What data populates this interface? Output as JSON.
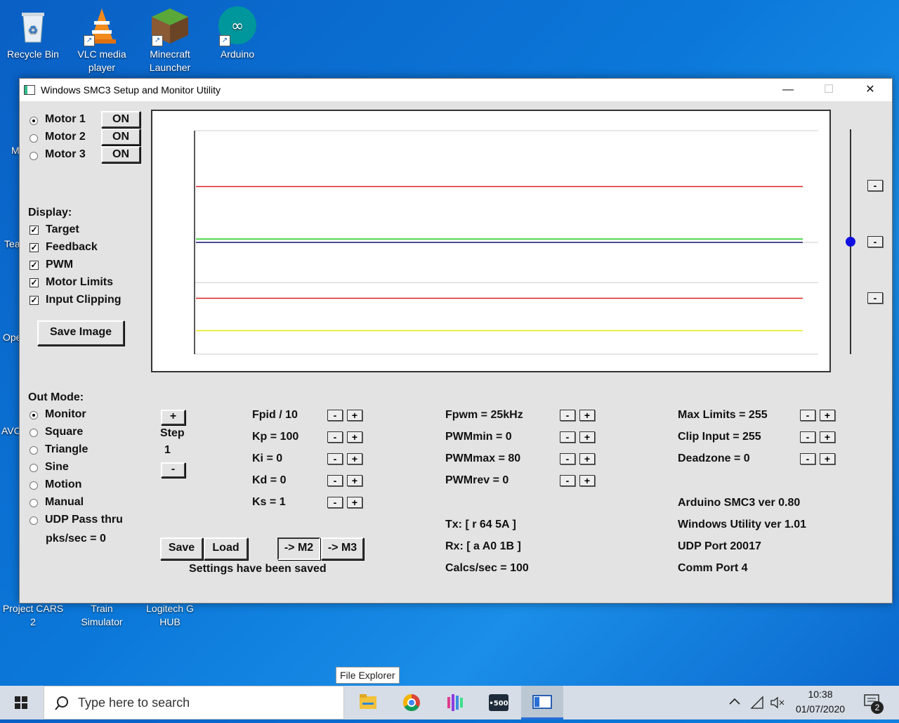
{
  "desktop": {
    "icons": [
      {
        "label_1": "Recycle Bin",
        "label_2": "",
        "icon": "recycle-bin-icon"
      },
      {
        "label_1": "VLC media",
        "label_2": "player",
        "icon": "vlc-cone-icon"
      },
      {
        "label_1": "Minecraft",
        "label_2": "Launcher",
        "icon": "minecraft-grass-block-icon"
      },
      {
        "label_1": "Arduino",
        "label_2": "",
        "icon": "arduino-infinity-icon"
      },
      {
        "label_1": "Project CARS",
        "label_2": "2",
        "icon": "project-cars-icon"
      },
      {
        "label_1": "Train",
        "label_2": "Simulator",
        "icon": "train-simulator-icon"
      },
      {
        "label_1": "Logitech G",
        "label_2": "HUB",
        "icon": "logitech-g-hub-icon"
      }
    ],
    "partial_labels": [
      "M",
      "Tea",
      "Ope",
      "AVC",
      "AVC"
    ]
  },
  "window": {
    "title": "Windows SMC3 Setup and Monitor Utility",
    "controls": {
      "minimize": "—",
      "maximize": "☐",
      "close": "✕"
    }
  },
  "motors": [
    {
      "label": "Motor 1",
      "selected": true,
      "state": "ON"
    },
    {
      "label": "Motor 2",
      "selected": false,
      "state": "ON"
    },
    {
      "label": "Motor 3",
      "selected": false,
      "state": "ON"
    }
  ],
  "display": {
    "heading": "Display:",
    "options": [
      {
        "label": "Target",
        "checked": true
      },
      {
        "label": "Feedback",
        "checked": true
      },
      {
        "label": "PWM",
        "checked": true
      },
      {
        "label": "Motor Limits",
        "checked": true
      },
      {
        "label": "Input Clipping",
        "checked": true
      }
    ],
    "save_image": "Save Image"
  },
  "out_mode": {
    "heading": "Out Mode:",
    "options": [
      {
        "label": "Monitor",
        "selected": true
      },
      {
        "label": "Square",
        "selected": false
      },
      {
        "label": "Triangle",
        "selected": false
      },
      {
        "label": "Sine",
        "selected": false
      },
      {
        "label": "Motion",
        "selected": false
      },
      {
        "label": "Manual",
        "selected": false
      },
      {
        "label": "UDP Pass thru",
        "selected": false
      }
    ],
    "pks": "pks/sec = 0"
  },
  "step": {
    "plus": "+",
    "label": "Step",
    "value": "1",
    "minus": "-"
  },
  "pid": [
    {
      "label": "Fpid / 10"
    },
    {
      "label": "Kp = 100"
    },
    {
      "label": "Ki = 0"
    },
    {
      "label": "Kd = 0"
    },
    {
      "label": "Ks = 1"
    }
  ],
  "pwm": [
    {
      "label": "Fpwm = 25kHz"
    },
    {
      "label": "PWMmin = 0"
    },
    {
      "label": "PWMmax = 80"
    },
    {
      "label": "PWMrev = 0"
    }
  ],
  "limits": [
    {
      "label": "Max Limits = 255"
    },
    {
      "label": "Clip Input = 255"
    },
    {
      "label": "Deadzone = 0"
    }
  ],
  "comms": {
    "tx": "Tx: [ r 64 5A ]",
    "rx": "Rx: [ a A0 1B ]",
    "calcs": "Calcs/sec = 100"
  },
  "info": {
    "firmware": "Arduino SMC3 ver 0.80",
    "utility": "Windows Utility ver 1.01",
    "udp": "UDP Port 20017",
    "comm": "Comm Port 4"
  },
  "buttons": {
    "save": "Save",
    "load": "Load",
    "to_m2": "-> M2",
    "to_m3": "-> M3",
    "status": "Settings have been saved",
    "minus": "-",
    "plus": "+"
  },
  "side_buttons": [
    "-",
    "-",
    "-"
  ],
  "slider_level": 0.5,
  "graph": {
    "series": [
      {
        "color": "#e02020",
        "level": 0.25
      },
      {
        "color": "#30d030",
        "level": 0.485
      },
      {
        "color": "#101070",
        "level": 0.5
      },
      {
        "color": "#e02020",
        "level": 0.75
      },
      {
        "color": "#e8e820",
        "level": 0.895
      }
    ],
    "gridlines": [
      0.0,
      0.5,
      0.68,
      1.0
    ]
  },
  "taskbar": {
    "search_placeholder": "Type here to search",
    "tooltip": "File Explorer",
    "apps": [
      "file-explorer-icon",
      "chrome-icon",
      "bars-app-icon",
      "500-app-icon",
      "smc3-window-icon"
    ],
    "time": "10:38",
    "date": "01/07/2020",
    "notifications": "2"
  }
}
